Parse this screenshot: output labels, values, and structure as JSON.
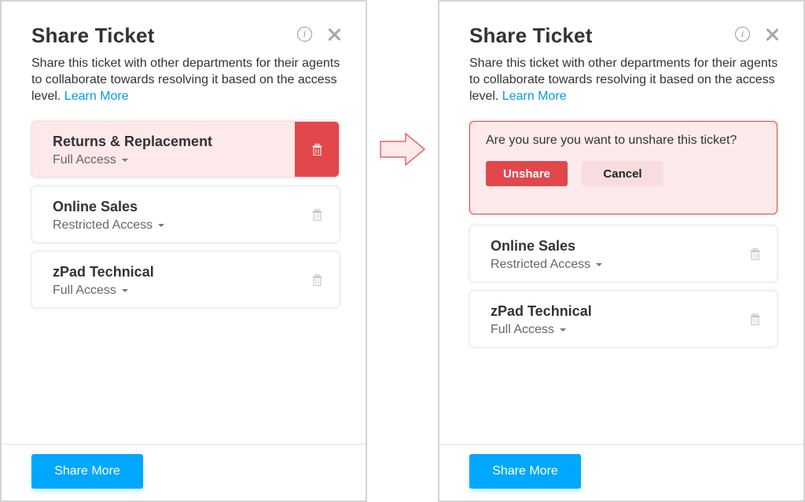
{
  "colors": {
    "accent": "#00a7ff",
    "link": "#039be5",
    "danger": "#e2474c",
    "danger_bg": "#fdeaea"
  },
  "panels": [
    {
      "state": "before",
      "title": "Share Ticket",
      "description": "Share this ticket with other departments for their agents to collaborate towards resolving it based on the access level. ",
      "learn_more": "Learn More",
      "icons": {
        "info": "info-icon",
        "close": "close-icon"
      },
      "departments": [
        {
          "name": "Returns & Replacement",
          "access": "Full Access",
          "highlighted": true
        },
        {
          "name": "Online Sales",
          "access": "Restricted Access",
          "highlighted": false
        },
        {
          "name": "zPad Technical",
          "access": "Full Access",
          "highlighted": false
        }
      ],
      "share_more": "Share More"
    },
    {
      "state": "after",
      "title": "Share Ticket",
      "description": "Share this ticket with other departments for their agents to collaborate towards resolving it based on the access level. ",
      "learn_more": "Learn More",
      "icons": {
        "info": "info-icon",
        "close": "close-icon"
      },
      "confirm": {
        "question": "Are you sure you want to unshare this ticket?",
        "unshare": "Unshare",
        "cancel": "Cancel"
      },
      "departments": [
        {
          "name": "Online Sales",
          "access": "Restricted Access"
        },
        {
          "name": "zPad Technical",
          "access": "Full Access"
        }
      ],
      "share_more": "Share More"
    }
  ],
  "transition_icon": "arrow-right-icon"
}
